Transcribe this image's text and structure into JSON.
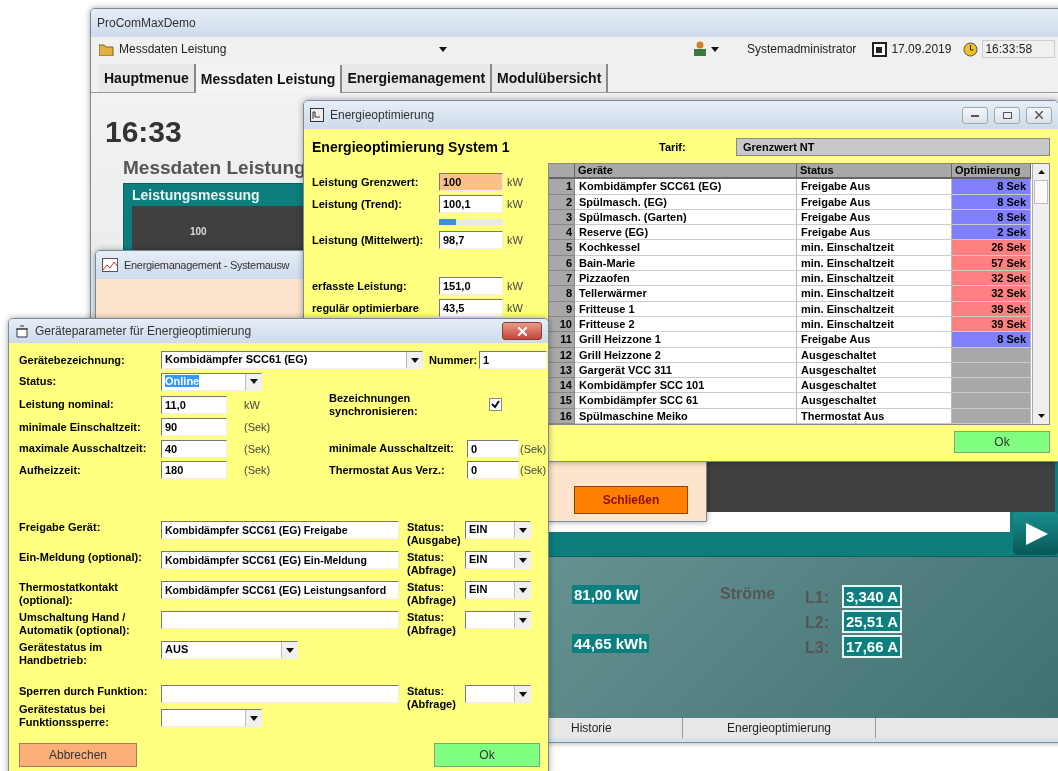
{
  "main_window": {
    "title": "ProComMaxDemo",
    "toolbar": {
      "module": "Messdaten Leistung",
      "user": "Systemadministrator",
      "date": "17.09.2019",
      "time": "16:33:58"
    },
    "tabs": [
      {
        "label": "Hauptmenue",
        "selected": false
      },
      {
        "label": "Messdaten Leistung",
        "selected": true
      },
      {
        "label": "Energiemanagement",
        "selected": false
      },
      {
        "label": "Modulübersicht",
        "selected": false
      }
    ],
    "clock": "16:33",
    "heading": "Messdaten Leistung",
    "panel": {
      "title": "Leistungsmessung",
      "y_tick": "100"
    },
    "readings": {
      "power": "81,00 kW",
      "energy": "44,65 kWh",
      "currents_label": "Ströme",
      "currents": [
        {
          "label": "L1:",
          "value": "3,340 A"
        },
        {
          "label": "L2:",
          "value": "25,51 A"
        },
        {
          "label": "L3:",
          "value": "17,66 A"
        }
      ]
    },
    "bottom_tabs": [
      "Historie",
      "Energieoptimierung"
    ]
  },
  "system_window": {
    "title": "Energiemanagement - Systemausw",
    "close_button": "Schließen"
  },
  "optimization_window": {
    "title": "Energieoptimierung",
    "heading": "Energieoptimierung System 1",
    "tariff_label": "Tarif:",
    "tariff": "Grenzwert NT",
    "fields": [
      {
        "kind": "value",
        "label": "Leistung Grenzwert:",
        "value": "100",
        "unit": "kW",
        "highlighted": true
      },
      {
        "kind": "value",
        "label": "Leistung (Trend):",
        "value": "100,1",
        "unit": "kW",
        "highlighted": false
      },
      {
        "kind": "bar",
        "level": 0.27
      },
      {
        "kind": "value",
        "label": "Leistung (Mittelwert):",
        "value": "98,7",
        "unit": "kW",
        "highlighted": false
      },
      {
        "kind": "gap"
      },
      {
        "kind": "value",
        "label": "erfasste Leistung:",
        "value": "151,0",
        "unit": "kW",
        "highlighted": false
      },
      {
        "kind": "value",
        "label": "regulär optimierbare",
        "value": "43,5",
        "unit": "kW",
        "highlighted": false
      }
    ],
    "table": {
      "columns": [
        "Geräte",
        "Status",
        "Optimierung"
      ],
      "rows": [
        {
          "number": "1",
          "device": "Kombidämpfer SCC61 (EG)",
          "status": "Freigabe Aus",
          "optimization": "8 Sek",
          "color": "#8080ff"
        },
        {
          "number": "2",
          "device": "Spülmasch. (EG)",
          "status": "Freigabe Aus",
          "optimization": "8 Sek",
          "color": "#8080ff"
        },
        {
          "number": "3",
          "device": "Spülmasch. (Garten)",
          "status": "Freigabe Aus",
          "optimization": "8 Sek",
          "color": "#8080ff"
        },
        {
          "number": "4",
          "device": "Reserve (EG)",
          "status": "Freigabe Aus",
          "optimization": "2 Sek",
          "color": "#8080ff"
        },
        {
          "number": "5",
          "device": "Kochkessel",
          "status": "min. Einschaltzeit",
          "optimization": "26 Sek",
          "color": "#ff8080"
        },
        {
          "number": "6",
          "device": "Bain-Marie",
          "status": "min. Einschaltzeit",
          "optimization": "57 Sek",
          "color": "#ff8080"
        },
        {
          "number": "7",
          "device": "Pizzaofen",
          "status": "min. Einschaltzeit",
          "optimization": "32 Sek",
          "color": "#ff8080"
        },
        {
          "number": "8",
          "device": "Tellerwärmer",
          "status": "min. Einschaltzeit",
          "optimization": "32 Sek",
          "color": "#ff8080"
        },
        {
          "number": "9",
          "device": "Fritteuse 1",
          "status": "min. Einschaltzeit",
          "optimization": "39 Sek",
          "color": "#ff8080"
        },
        {
          "number": "10",
          "device": "Fritteuse 2",
          "status": "min. Einschaltzeit",
          "optimization": "39 Sek",
          "color": "#ff8080"
        },
        {
          "number": "11",
          "device": "Grill Heizzone 1",
          "status": "Freigabe Aus",
          "optimization": "8 Sek",
          "color": "#8080ff"
        },
        {
          "number": "12",
          "device": "Grill Heizzone 2",
          "status": "Ausgeschaltet"
        },
        {
          "number": "13",
          "device": "Gargerät VCC 311",
          "status": "Ausgeschaltet"
        },
        {
          "number": "14",
          "device": "Kombidämpfer SCC 101",
          "status": "Ausgeschaltet"
        },
        {
          "number": "15",
          "device": "Kombidämpfer SCC 61",
          "status": "Ausgeschaltet"
        },
        {
          "number": "16",
          "device": "Spülmaschine Meiko",
          "status": "Thermostat Aus"
        }
      ]
    },
    "ok_button": "Ok"
  },
  "parameter_dialog": {
    "title": "Geräteparameter für Energieoptimierung",
    "device": {
      "label": "Gerätebezeichnung:",
      "value": "Kombidämpfer SCC61 (EG)"
    },
    "number": {
      "label": "Nummer:",
      "value": "1"
    },
    "status": {
      "label": "Status:",
      "value": "Online",
      "text_selected": true
    },
    "nominal": {
      "label": "Leistung nominal:",
      "value": "11,0",
      "unit": "kW"
    },
    "sync": {
      "label": "Bezeichnungen synchronisieren:",
      "checked": true
    },
    "timings": [
      {
        "label": "minimale Einschaltzeit:",
        "value": "90",
        "unit": "(Sek)"
      },
      {
        "label": "maximale Ausschaltzeit:",
        "value": "40",
        "unit": "(Sek)",
        "right": {
          "label": "minimale Ausschaltzeit:",
          "value": "0",
          "unit": "(Sek)"
        }
      },
      {
        "label": "Aufheizzeit:",
        "value": "180",
        "unit": "(Sek)",
        "right": {
          "label": "Thermostat Aus Verz.:",
          "value": "0",
          "unit": "(Sek)"
        }
      }
    ],
    "signals": [
      {
        "label": "Freigabe Gerät:",
        "value": "Kombidämpfer SCC61 (EG) Freigabe",
        "status_label": "Status:",
        "status_kind": "(Ausgabe)",
        "status": "EIN"
      },
      {
        "label": "Ein-Meldung (optional):",
        "value": "Kombidämpfer SCC61 (EG) Ein-Meldung",
        "status_label": "Status:",
        "status_kind": "(Abfrage)",
        "status": "EIN"
      },
      {
        "label": "Thermostatkontakt (optional):",
        "value": "Kombidämpfer SCC61 (EG) Leistungsanford",
        "status_label": "Status:",
        "status_kind": "(Abfrage)",
        "status": "EIN"
      },
      {
        "label": "Umschaltung Hand / Automatik (optional):",
        "status_label": "Status:",
        "status_kind": "(Abfrage)"
      }
    ],
    "manual_state": {
      "label": "Gerätestatus im Handbetrieb:",
      "value": "AUS"
    },
    "lock": {
      "label": "Sperren durch Funktion:",
      "status_label": "Status:",
      "status_kind": "(Abfrage)"
    },
    "lock_state": {
      "label": "Gerätestatus bei Funktionssperre:"
    },
    "cancel_button": "Abbrechen",
    "ok_button": "Ok"
  }
}
